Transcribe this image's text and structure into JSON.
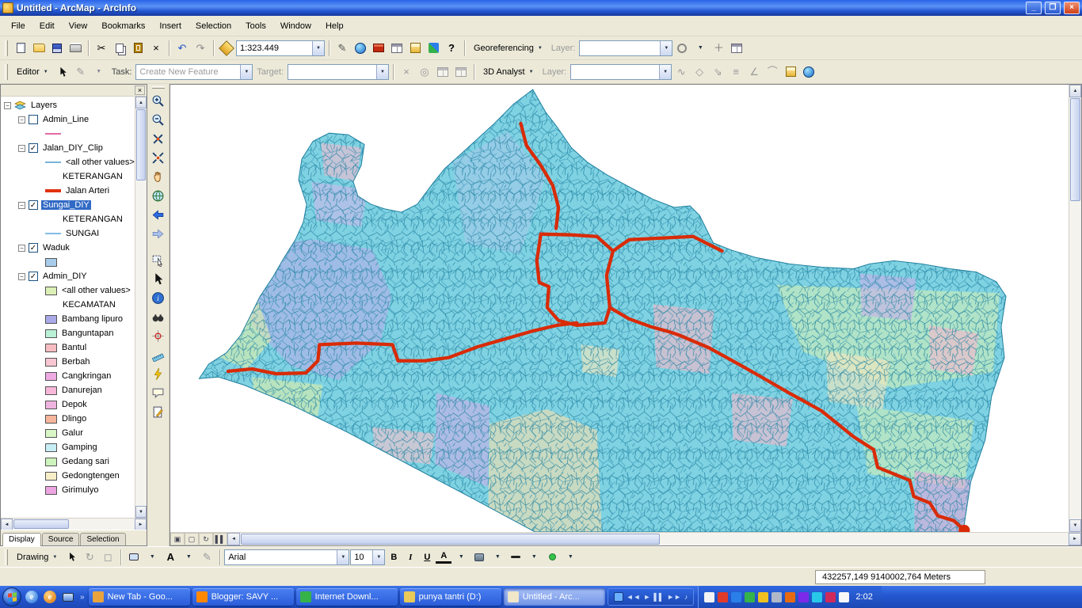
{
  "window": {
    "title": "Untitled - ArcMap - ArcInfo"
  },
  "icons": {
    "check": "✓",
    "minus": "−",
    "arrow_down": "▼",
    "arrow_up": "▲",
    "arrow_left": "◄",
    "arrow_right": "►",
    "close": "×",
    "chevron": "»",
    "scissors": "✂",
    "undo": "↶",
    "redo": "↷",
    "question": "?",
    "pencil": "✎",
    "cursor": "➤",
    "refresh": "↻",
    "prev": "◄◄",
    "play": "►",
    "pause": "▌▌",
    "next": "►►",
    "note": "♪"
  },
  "menu": {
    "items": [
      "File",
      "Edit",
      "View",
      "Bookmarks",
      "Insert",
      "Selection",
      "Tools",
      "Window",
      "Help"
    ]
  },
  "standard_toolbar": {
    "scale_value": "1:323.449",
    "georeferencing_label": "Georeferencing",
    "layer_label": "Layer:"
  },
  "editor_toolbar": {
    "editor_label": "Editor",
    "task_label": "Task:",
    "task_value": "Create New Feature",
    "target_label": "Target:",
    "analyst_label": "3D Analyst",
    "layer_label": "Layer:"
  },
  "toc": {
    "root_label": "Layers",
    "items": [
      {
        "label": "Admin_Line",
        "checked": false
      },
      {
        "symbol": "line",
        "color": "#e36ba6"
      },
      {
        "label": "Jalan_DIY_Clip",
        "checked": true
      },
      {
        "label": "<all other values>",
        "symbol": "line",
        "color": "#7ab3d9"
      },
      {
        "label": "KETERANGAN"
      },
      {
        "label": "Jalan Arteri",
        "symbol": "thickline",
        "color": "#e0320e"
      },
      {
        "label": "Sungai_DIY",
        "checked": true,
        "selected": true
      },
      {
        "label": "KETERANGAN"
      },
      {
        "label": "SUNGAI",
        "symbol": "line",
        "color": "#82bce6"
      },
      {
        "label": "Waduk",
        "checked": true
      },
      {
        "symbol": "patch",
        "color": "#a8cdea"
      },
      {
        "label": "Admin_DIY",
        "checked": true
      },
      {
        "label": "<all other values>",
        "symbol": "patch",
        "color": "#daf0b4"
      },
      {
        "label": "KECAMATAN"
      },
      {
        "label": "Bambang lipuro",
        "symbol": "patch",
        "color": "#aaa9e8"
      },
      {
        "label": "Banguntapan",
        "symbol": "patch",
        "color": "#b9f0d6"
      },
      {
        "label": "Bantul",
        "symbol": "patch",
        "color": "#f6bcc1"
      },
      {
        "label": "Berbah",
        "symbol": "patch",
        "color": "#f8c6d2"
      },
      {
        "label": "Cangkringan",
        "symbol": "patch",
        "color": "#eeaae2"
      },
      {
        "label": "Danurejan",
        "symbol": "patch",
        "color": "#f6b7d8"
      },
      {
        "label": "Depok",
        "symbol": "patch",
        "color": "#efb3e0"
      },
      {
        "label": "Dlingo",
        "symbol": "patch",
        "color": "#f6b69c"
      },
      {
        "label": "Galur",
        "symbol": "patch",
        "color": "#d8f6c6"
      },
      {
        "label": "Gamping",
        "symbol": "patch",
        "color": "#c6eef4"
      },
      {
        "label": "Gedang sari",
        "symbol": "patch",
        "color": "#cdf4bd"
      },
      {
        "label": "Gedongtengen",
        "symbol": "patch",
        "color": "#f8eec8"
      },
      {
        "label": "Girimulyo",
        "symbol": "patch",
        "color": "#eca5e0"
      }
    ],
    "tabs": [
      "Display",
      "Source",
      "Selection"
    ]
  },
  "map": {
    "base_color": "#7fd2e2",
    "network_color": "#1f7f9e",
    "road_color": "#d92b07"
  },
  "drawing_toolbar": {
    "label": "Drawing",
    "text_tool": "A",
    "font_value": "Arial",
    "size_value": "10",
    "bold": "B",
    "italic": "I",
    "underline": "U",
    "font_color_label": "A"
  },
  "statusbar": {
    "coordinates": "432257,149 9140002,764 Meters"
  },
  "taskbar": {
    "buttons": [
      {
        "label": "New Tab - Goo...",
        "color": "#e8a33d"
      },
      {
        "label": "Blogger: SAVY ...",
        "color": "#ff8800"
      },
      {
        "label": "Internet Downl...",
        "color": "#35b24a"
      },
      {
        "label": "punya tantri (D:)",
        "color": "#e8c95a"
      },
      {
        "label": "Untitled - Arc...",
        "color": "#f0e6c8"
      }
    ],
    "time": "2:02"
  }
}
